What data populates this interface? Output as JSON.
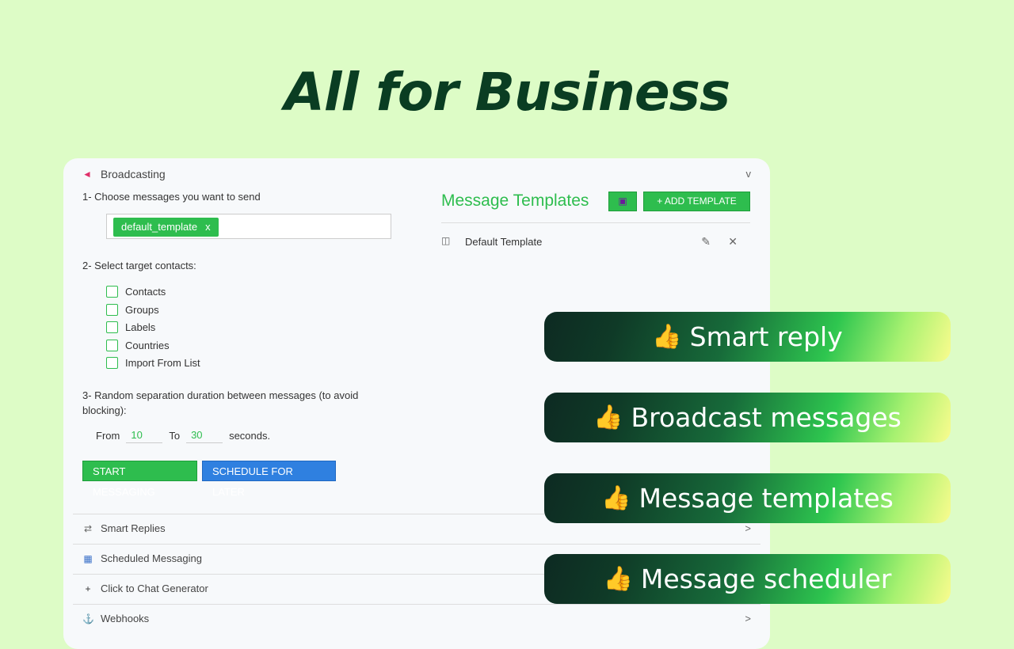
{
  "hero": {
    "title": "All for Business"
  },
  "broadcast": {
    "header": "Broadcasting",
    "chevron": "v",
    "step1": "1- Choose messages you want to send",
    "chip_label": "default_template",
    "chip_remove": "x",
    "step2": "2- Select target contacts:",
    "contacts": [
      "Contacts",
      "Groups",
      "Labels",
      "Countries",
      "Import From List"
    ],
    "step3": "3- Random separation duration between messages (to avoid blocking):",
    "from_label": "From",
    "from_value": "10",
    "to_label": "To",
    "to_value": "30",
    "seconds_label": "seconds.",
    "start_button": "START MESSAGING",
    "schedule_button": "SCHEDULE FOR LATER"
  },
  "templates": {
    "title": "Message Templates",
    "add_button": "+ ADD TEMPLATE",
    "items": [
      "Default Template"
    ]
  },
  "sections": [
    {
      "label": "Smart Replies",
      "icon": "swap-icon",
      "chevron": ">"
    },
    {
      "label": "Scheduled Messaging",
      "icon": "calendar-icon",
      "chevron": ""
    },
    {
      "label": "Click to Chat Generator",
      "icon": "plus-icon",
      "chevron": ""
    },
    {
      "label": "Webhooks",
      "icon": "anchor-icon",
      "chevron": ">"
    }
  ],
  "features": [
    "Smart reply",
    "Broadcast messages",
    "Message templates",
    "Message scheduler"
  ],
  "colors": {
    "background": "#ddfcc6",
    "accent_green": "#2ebd4e",
    "accent_blue": "#2f80e0",
    "title": "#0a3d22"
  }
}
